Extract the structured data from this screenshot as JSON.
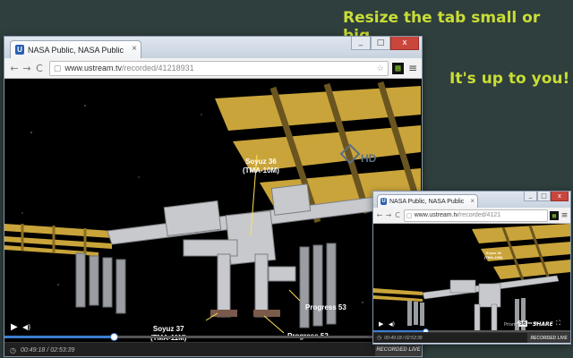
{
  "promo": {
    "headline": "Resize the tab small or big.",
    "tagline": "It's up to you!"
  },
  "colors": {
    "promo_text": "#c9dd36",
    "background": "#2f3f3d",
    "progress": "#3b7fd0"
  },
  "browser": {
    "tab_title": "NASA Public, NASA Public",
    "tab_icon": "U",
    "close_glyph": "×",
    "back_glyph": "←",
    "forward_glyph": "→",
    "reload_glyph": "C",
    "url_host": "www.ustream.tv",
    "url_path": "/recorded/41218931",
    "extension_glyph": "▦",
    "menu_glyph": "≡",
    "window_controls": {
      "minimize": "_",
      "maximize": "□",
      "close": "x"
    }
  },
  "small_browser": {
    "tab_title": "NASA Public, NASA Public",
    "url_host": "www.ustream.tv",
    "url_path": "/recorded/4121",
    "extension_glyph": "▦"
  },
  "video": {
    "labels": {
      "soyuz36": "Soyuz 36\n(TMA-10M)",
      "soyuz37": "Soyuz 37\n(TMA-11M)",
      "progress53": "Progress 53",
      "progress52": "Progress 52"
    },
    "hd_badge": "HD",
    "play_glyph": "▶",
    "volume_glyph": "◀)",
    "time_elapsed": "00:49:18",
    "time_separator": "/",
    "time_total": "02:53:39",
    "progress_fraction": 0.26,
    "recorded_live": "RECORDED LIVE",
    "share": "SHARE",
    "share_count": "56",
    "prism": "Prism"
  },
  "small_video": {
    "time_elapsed": "00:49:18",
    "time_total": "02:53:39",
    "progress_fraction": 0.26,
    "recorded_live": "RECORDED LIVE"
  }
}
